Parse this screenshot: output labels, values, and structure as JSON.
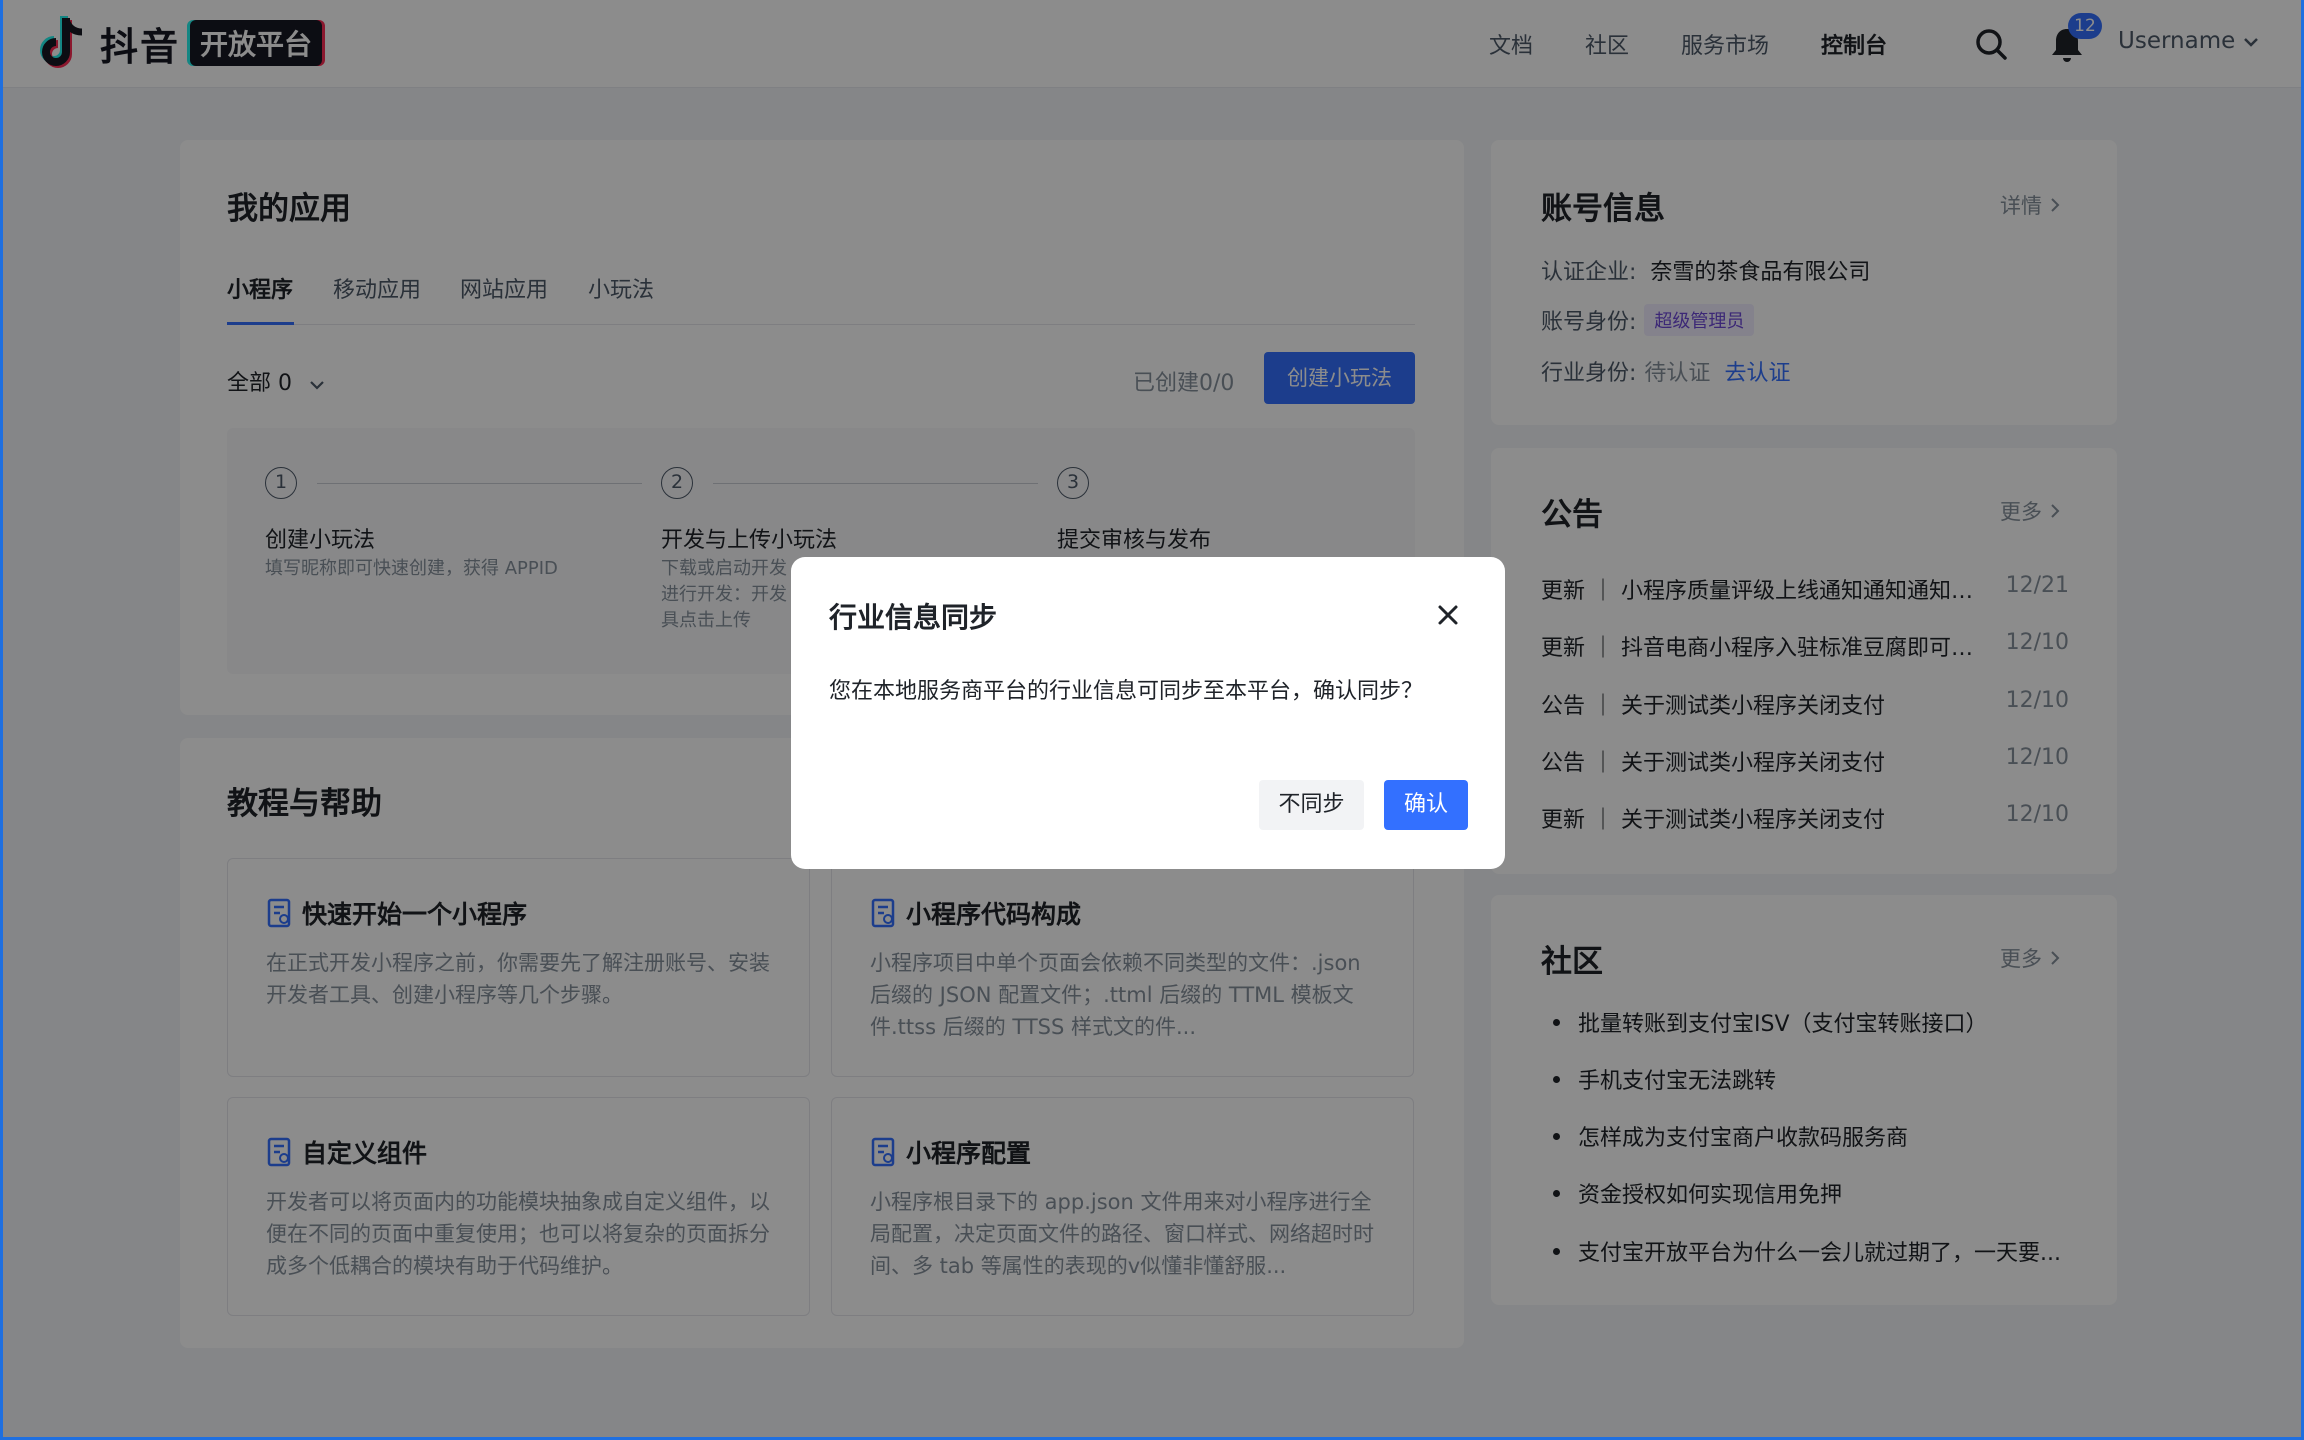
{
  "header": {
    "logo_text": "抖音",
    "logo_badge": "开放平台",
    "nav": [
      "文档",
      "社区",
      "服务市场",
      "控制台"
    ],
    "active_nav": "控制台",
    "notification_count": "12",
    "username": "Username"
  },
  "apps": {
    "title": "我的应用",
    "tabs": [
      "小程序",
      "移动应用",
      "网站应用",
      "小玩法"
    ],
    "filter_label": "全部 0",
    "created_count": "已创建0/0",
    "create_button": "创建小玩法",
    "steps": [
      {
        "num": "1",
        "title": "创建小玩法",
        "desc": "填写昵称即可快速创建，获得 APPID"
      },
      {
        "num": "2",
        "title": "开发与上传小玩法",
        "desc": "下载或启动开发\n进行开发：开发\n具点击上传"
      },
      {
        "num": "3",
        "title": "提交审核与发布",
        "desc": ""
      }
    ]
  },
  "help": {
    "title": "教程与帮助",
    "cards": [
      {
        "title": "快速开始一个小程序",
        "desc": "在正式开发小程序之前，你需要先了解注册账号、安装开发者工具、创建小程序等几个步骤。"
      },
      {
        "title": "小程序代码构成",
        "desc": "小程序项目中单个页面会依赖不同类型的文件：.json 后缀的 JSON 配置文件；.ttml 后缀的 TTML 模板文件.ttss 后缀的 TTSS 样式文的件..."
      },
      {
        "title": "自定义组件",
        "desc": "开发者可以将页面内的功能模块抽象成自定义组件，以便在不同的页面中重复使用；也可以将复杂的页面拆分成多个低耦合的模块有助于代码维护。"
      },
      {
        "title": "小程序配置",
        "desc": "小程序根目录下的 app.json 文件用来对小程序进行全局配置，决定页面文件的路径、窗口样式、网络超时时间、多 tab 等属性的表现的v似懂非懂舒服..."
      }
    ]
  },
  "account": {
    "title": "账号信息",
    "detail_link": "详情",
    "company_label": "认证企业:",
    "company": "奈雪的茶食品有限公司",
    "role_label": "账号身份:",
    "role": "超级管理员",
    "industry_label": "行业身份:",
    "industry_status": "待认证",
    "industry_link": "去认证"
  },
  "notices": {
    "title": "公告",
    "more": "更多",
    "items": [
      {
        "text": "更新 ｜ 小程序质量评级上线通知通知通知通知",
        "date": "12/21"
      },
      {
        "text": "更新 ｜ 抖音电商小程序入驻标准豆腐即可豆腐",
        "date": "12/10"
      },
      {
        "text": "公告 ｜ 关于测试类小程序关闭支付",
        "date": "12/10"
      },
      {
        "text": "公告 ｜ 关于测试类小程序关闭支付",
        "date": "12/10"
      },
      {
        "text": "更新 ｜ 关于测试类小程序关闭支付",
        "date": "12/10"
      }
    ]
  },
  "community": {
    "title": "社区",
    "more": "更多",
    "items": [
      "批量转账到支付宝ISV（支付宝转账接口）",
      "手机支付宝无法跳转",
      "怎样成为支付宝商户收款码服务商",
      "资金授权如何实现信用免押",
      "支付宝开放平台为什么一会儿就过期了，一天要..."
    ]
  },
  "modal": {
    "title": "行业信息同步",
    "body": "您在本地服务商平台的行业信息可同步至本平台，确认同步？",
    "cancel": "不同步",
    "confirm": "确认"
  },
  "colors": {
    "primary": "#3370ff",
    "overlay": "rgba(0,0,0,0.45)",
    "role_tag": "#6e49d8"
  }
}
